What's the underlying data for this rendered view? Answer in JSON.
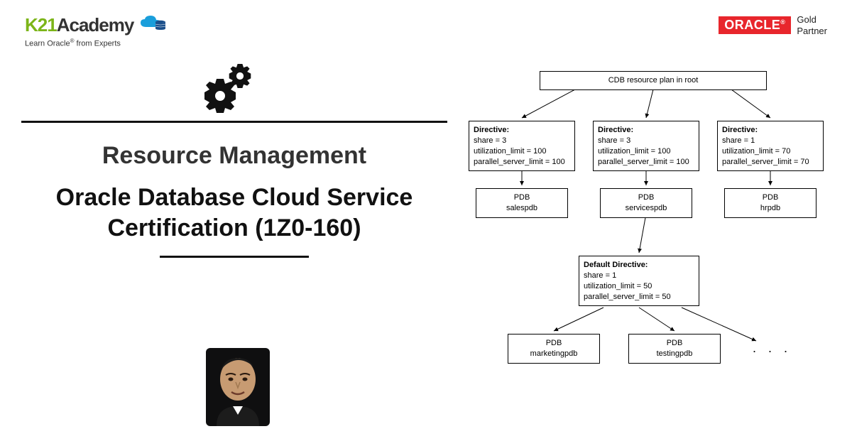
{
  "logo": {
    "prefix": "K21",
    "suffix": "Academy",
    "tagline_pre": "Learn Oracle",
    "tagline_post": " from Experts"
  },
  "partner": {
    "brand": "ORACLE",
    "line1": "Gold",
    "line2": "Partner"
  },
  "titles": {
    "subtitle": "Resource Management",
    "main": "Oracle Database Cloud Service Certification (1Z0-160)"
  },
  "chart_data": {
    "type": "tree",
    "root": {
      "label": "CDB resource plan in root"
    },
    "directives": [
      {
        "title": "Directive:",
        "share": 3,
        "utilization_limit": 100,
        "parallel_server_limit": 100,
        "pdb": "salespdb"
      },
      {
        "title": "Directive:",
        "share": 3,
        "utilization_limit": 100,
        "parallel_server_limit": 100,
        "pdb": "servicespdb"
      },
      {
        "title": "Directive:",
        "share": 1,
        "utilization_limit": 70,
        "parallel_server_limit": 70,
        "pdb": "hrpdb"
      }
    ],
    "default_directive": {
      "title": "Default Directive:",
      "share": 1,
      "utilization_limit": 50,
      "parallel_server_limit": 50,
      "pdbs": [
        "marketingpdb",
        "testingpdb"
      ]
    },
    "pdb_label": "PDB",
    "ellipsis": ". . ."
  }
}
